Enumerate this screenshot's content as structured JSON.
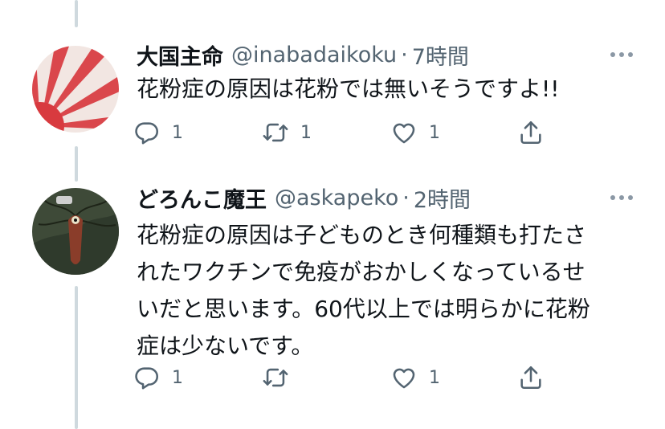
{
  "tweets": [
    {
      "display_name": "大国主命",
      "handle": "@inabadaikoku",
      "separator": "·",
      "time": "7時間",
      "lines": [
        "花粉症の原因は花粉では無いそうですよ!!"
      ],
      "reply_count": "1",
      "retweet_count": "1",
      "like_count": "1",
      "avatar": "rising-sun-flag",
      "icons": [
        "reply-icon",
        "retweet-icon",
        "like-icon",
        "share-icon",
        "more-icon"
      ]
    },
    {
      "display_name": "どろんこ魔王",
      "handle": "@askapeko",
      "separator": "·",
      "time": "2時間",
      "lines": [
        "花粉症の原因は子どものとき何種類も打たさ",
        "れたワクチンで免疫がおかしくなっているせ",
        "いだと思います。60代以上では明らかに花粉",
        "症は少ないです。"
      ],
      "reply_count": "1",
      "retweet_count": "",
      "like_count": "1",
      "avatar": "monster-illustration",
      "icons": [
        "reply-icon",
        "retweet-icon",
        "like-icon",
        "share-icon",
        "more-icon"
      ]
    }
  ],
  "colors": {
    "text": "#0f1419",
    "secondary": "#536471",
    "thread_line": "#cfd9de",
    "avatar_red": "#d83a3f"
  }
}
